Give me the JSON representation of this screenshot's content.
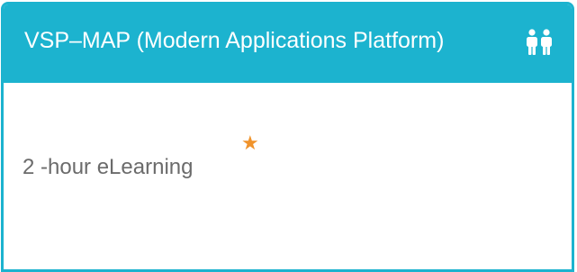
{
  "card": {
    "title": "VSP–MAP (Modern Applications Platform)",
    "header_icon": "people-icon",
    "course_format": "2 -hour eLearning",
    "badge_icon": "star-icon",
    "badge_glyph": "★"
  },
  "colors": {
    "header_background": "#1cb3cf",
    "title_text": "#ffffff",
    "body_text": "#6b6b6b",
    "star": "#f0932b"
  }
}
